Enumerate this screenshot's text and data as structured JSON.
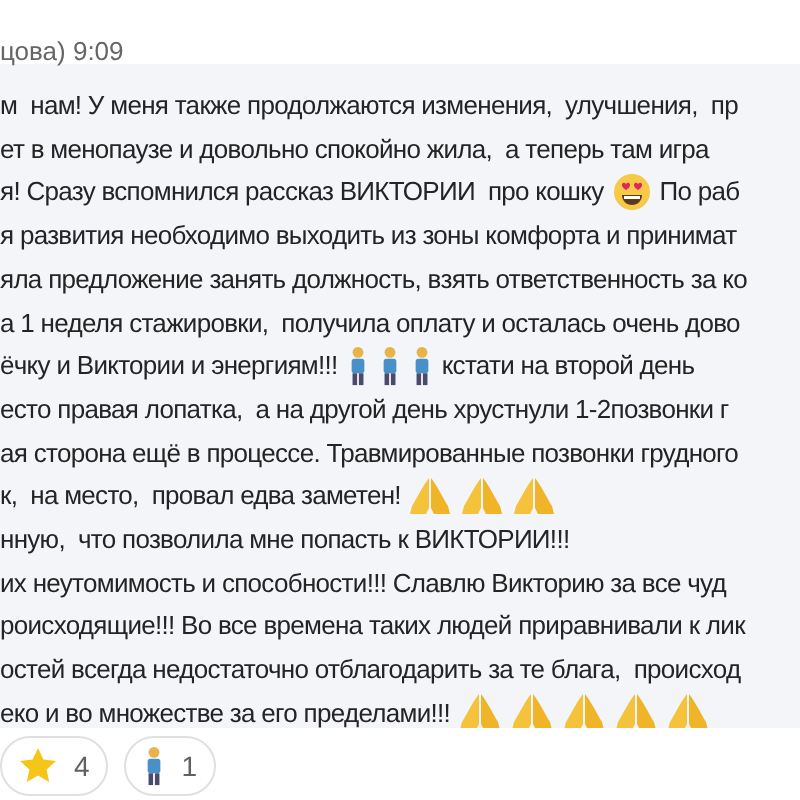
{
  "header": {
    "sender": "цова)",
    "time": "9:09"
  },
  "lines": [
    [
      {
        "kind": "text",
        "text": "м  нам! У меня также продолжаются изменения,  улучшения,  пр"
      }
    ],
    [
      {
        "kind": "text",
        "text": "ет в менопаузе и довольно спокойно жила,  а теперь там игра"
      }
    ],
    [
      {
        "kind": "text",
        "text": "я! Сразу вспомнился рассказ ВИКТОРИИ  про кошку"
      },
      {
        "kind": "smile"
      },
      {
        "kind": "text",
        "text": "По раб"
      }
    ],
    [
      {
        "kind": "text",
        "text": "я развития необходимо выходить из зоны комфорта и принимат"
      }
    ],
    [
      {
        "kind": "text",
        "text": "яла предложение занять должность, взять ответственность за ко"
      }
    ],
    [
      {
        "kind": "text",
        "text": "а 1 неделя стажировки,  получила оплату и осталась очень дово"
      }
    ],
    [
      {
        "kind": "text",
        "text": "ёчку и Виктории и энергиям!!!"
      },
      {
        "kind": "person"
      },
      {
        "kind": "person"
      },
      {
        "kind": "person"
      },
      {
        "kind": "text",
        "text": "кстати на второй день"
      }
    ],
    [
      {
        "kind": "text",
        "text": "есто правая лопатка,  а на другой день хрустнули 1-2позвонки г"
      }
    ],
    [
      {
        "kind": "text",
        "text": "ая сторона ещё в процессе. Травмированные позвонки грудного"
      }
    ],
    [
      {
        "kind": "text",
        "text": "к,  на место,  провал едва заметен!"
      },
      {
        "kind": "pray"
      },
      {
        "kind": "pray"
      },
      {
        "kind": "pray"
      }
    ],
    [
      {
        "kind": "text",
        "text": "нную,  что позволила мне попасть к ВИКТОРИИ!!!"
      }
    ],
    [
      {
        "kind": "text",
        "text": "их неутомимость и способности!!! Славлю Викторию за все чуд"
      }
    ],
    [
      {
        "kind": "text",
        "text": "роисходящие!!! Во все времена таких людей приравнивали к лик"
      }
    ],
    [
      {
        "kind": "text",
        "text": "остей всегда недостаточно отблагодарить за те блага,  происход"
      }
    ],
    [
      {
        "kind": "text",
        "text": "еко и во множестве за его пределами!!!"
      },
      {
        "kind": "pray"
      },
      {
        "kind": "pray"
      },
      {
        "kind": "pray"
      },
      {
        "kind": "pray"
      },
      {
        "kind": "pray"
      }
    ]
  ],
  "reactions": [
    {
      "kind": "star",
      "count": "4"
    },
    {
      "kind": "person",
      "count": "1"
    }
  ]
}
